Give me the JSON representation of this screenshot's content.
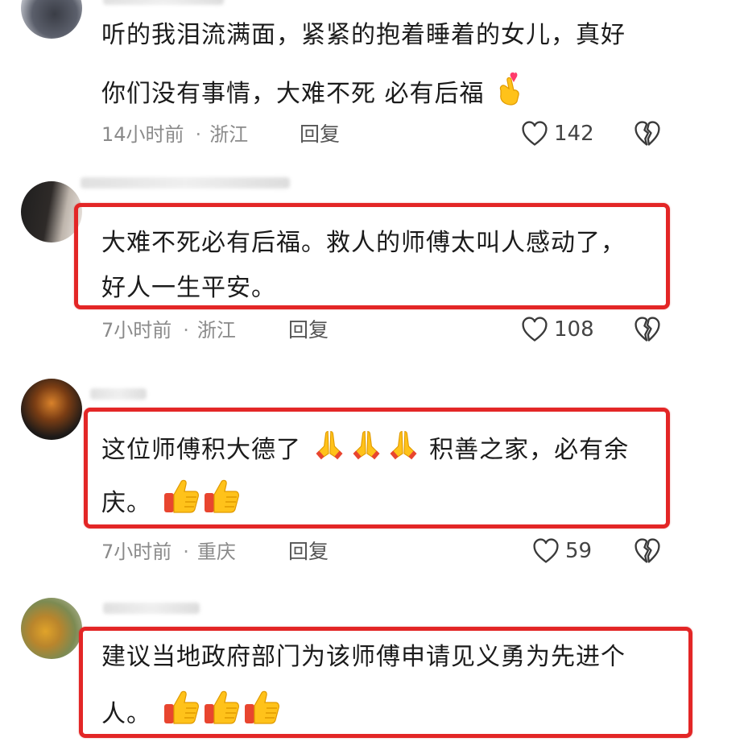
{
  "comments": [
    {
      "lines": [
        "听的我泪流满面，紧紧的抱着睡着的女儿，真好",
        "你们没有事情，大难不死 必有后福"
      ],
      "time": "14小时前",
      "location": "浙江",
      "reply": "回复",
      "likes": "142",
      "emojis": [
        "finger-heart-emoji"
      ],
      "highlighted": false
    },
    {
      "lines": [
        "大难不死必有后福。救人的师傅太叫人感动了，",
        "好人一生平安。"
      ],
      "time": "7小时前",
      "location": "浙江",
      "reply": "回复",
      "likes": "108",
      "highlighted": true
    },
    {
      "lines": [
        "这位师傅积大德了",
        "积善之家，必有余",
        "庆。"
      ],
      "time": "7小时前",
      "location": "重庆",
      "reply": "回复",
      "likes": "59",
      "emojis": [
        "praying-hands-emoji",
        "praying-hands-emoji",
        "praying-hands-emoji",
        "thumbs-up-emoji",
        "thumbs-up-emoji"
      ],
      "highlighted": true
    },
    {
      "lines": [
        "建议当地政府部门为该师傅申请见义勇为先进个",
        "人。"
      ],
      "emojis": [
        "thumbs-up-emoji",
        "thumbs-up-emoji",
        "thumbs-up-emoji"
      ],
      "highlighted": true
    }
  ],
  "colors": {
    "highlight_border": "#e32626",
    "meta_text": "#8a8a8a",
    "body_text": "#1b1b1b"
  },
  "icons": [
    "heart-outline-icon",
    "broken-heart-icon"
  ]
}
